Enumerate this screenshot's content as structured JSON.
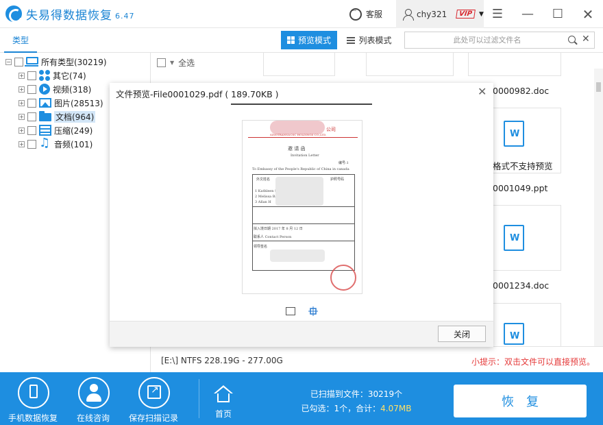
{
  "app": {
    "title": "失易得数据恢复",
    "version": "6.47",
    "service_label": "客服",
    "username": "chy321",
    "vip_badge": "VIP"
  },
  "toolbar": {
    "type_tab": "类型",
    "preview_mode": "预览模式",
    "list_mode": "列表模式",
    "filter_placeholder": "此处可以过滤文件名"
  },
  "tree": {
    "root": "所有类型(30219)",
    "items": [
      {
        "label": "其它(74)",
        "icon": "other-icon"
      },
      {
        "label": "视频(318)",
        "icon": "video-icon"
      },
      {
        "label": "图片(28513)",
        "icon": "picture-icon"
      },
      {
        "label": "文档(964)",
        "icon": "folder-icon"
      },
      {
        "label": "压缩(249)",
        "icon": "archive-icon"
      },
      {
        "label": "音频(101)",
        "icon": "music-icon"
      }
    ]
  },
  "content": {
    "select_all": "全选",
    "files": [
      "0000982.doc",
      "格式不支持预览",
      "0001049.ppt",
      "0001234.doc"
    ],
    "partition_info": "[E:\\] NTFS 228.19G - 277.00G",
    "tip": "小提示：双击文件可以直接预览。"
  },
  "dialog": {
    "title": "文件预览-File0001029.pdf ( 189.70KB )",
    "close_button": "关闭",
    "doc": {
      "company_suffix": "公司",
      "company_en": "SINOTRANS&CSC HOLDINGS CO.,LTD.",
      "heading": "邀 请 函",
      "heading_en": "Invitation Letter",
      "serial": "编号:1",
      "addressee": "To Embassy of the People's Republic of China in canada",
      "col_name": "外文姓名",
      "col_passport": "护照号码",
      "rows": [
        "1 Kathleen Sutto",
        "2 Melissa Barcellos",
        "3 Allan H"
      ],
      "entry_date": "拟入境日期 2017 年 8 月 12 日",
      "contact": "联系人 Contact Person",
      "signature": "领导签名"
    }
  },
  "bottom": {
    "phone_recovery": "手机数据恢复",
    "online_consult": "在线咨询",
    "save_scan": "保存扫描记录",
    "home": "首页",
    "scanned": "已扫描到文件：30219个",
    "selected_prefix": "已勾选：1个，合计：",
    "selected_size": "4.07MB",
    "recover": "恢复"
  },
  "colors": {
    "brand": "#1e8ee0",
    "tip": "#e53a3a",
    "vip": "#d8262d"
  }
}
